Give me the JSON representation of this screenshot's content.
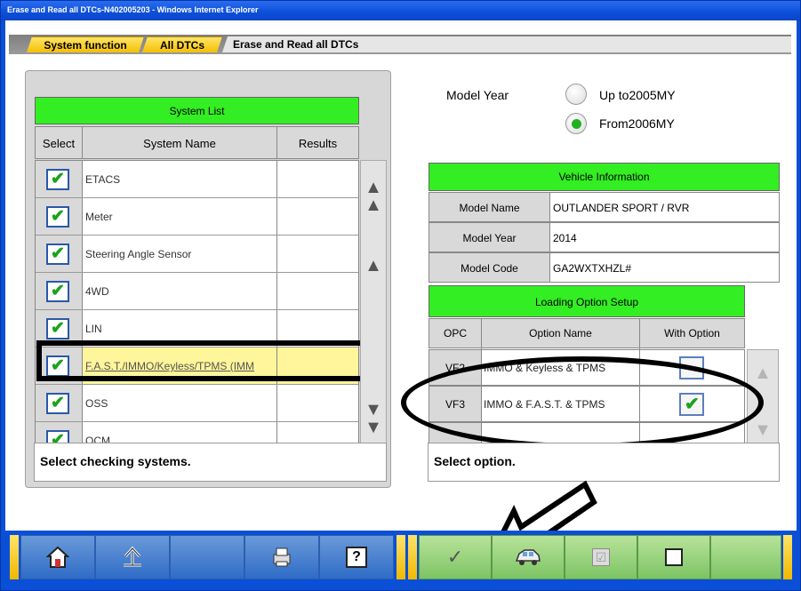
{
  "window": {
    "title": "Erase and Read all DTCs-N402005203 - Windows Internet Explorer"
  },
  "breadcrumb": {
    "items": [
      "System function",
      "All DTCs"
    ],
    "current": "Erase and Read all DTCs"
  },
  "system_list": {
    "title": "System List",
    "columns": [
      "Select",
      "System Name",
      "Results"
    ],
    "rows": [
      {
        "name": "ETACS",
        "checked": true
      },
      {
        "name": "Meter",
        "checked": true
      },
      {
        "name": "Steering Angle Sensor",
        "checked": true
      },
      {
        "name": "4WD",
        "checked": true
      },
      {
        "name": "LIN",
        "checked": true
      },
      {
        "name": "F.A.S.T./IMMO/Keyless/TPMS (IMM",
        "checked": true,
        "highlighted": true
      },
      {
        "name": "OSS",
        "checked": true
      },
      {
        "name": "OCM",
        "checked": true
      }
    ],
    "check_glyph": "✔"
  },
  "left_message": "Select checking systems.",
  "model_year": {
    "label": "Model Year",
    "options": [
      {
        "label": "Up to2005MY",
        "selected": false
      },
      {
        "label": "From2006MY",
        "selected": true
      }
    ]
  },
  "vehicle_info": {
    "title": "Vehicle Information",
    "rows": [
      {
        "key": "Model Name",
        "value": "OUTLANDER SPORT / RVR"
      },
      {
        "key": "Model Year",
        "value": "2014"
      },
      {
        "key": "Model Code",
        "value": "GA2WXTXHZL#"
      }
    ]
  },
  "loading_option": {
    "title": "Loading Option Setup",
    "columns": [
      "OPC",
      "Option Name",
      "With Option"
    ],
    "rows": [
      {
        "opc": "VF2",
        "name": "IMMO & Keyless & TPMS",
        "checked": false
      },
      {
        "opc": "VF3",
        "name": "IMMO & F.A.S.T. & TPMS",
        "checked": true
      }
    ]
  },
  "right_message": "Select option.",
  "colors": {
    "header_green": "#33ee22",
    "check_green": "#1aa31a",
    "toolbar_blue": "#0a4fd6"
  },
  "icons": {
    "home": "home-icon",
    "back": "back-arrow-icon",
    "print": "printer-icon",
    "help": "?",
    "ok": "✓",
    "vehicle": "car-icon"
  }
}
